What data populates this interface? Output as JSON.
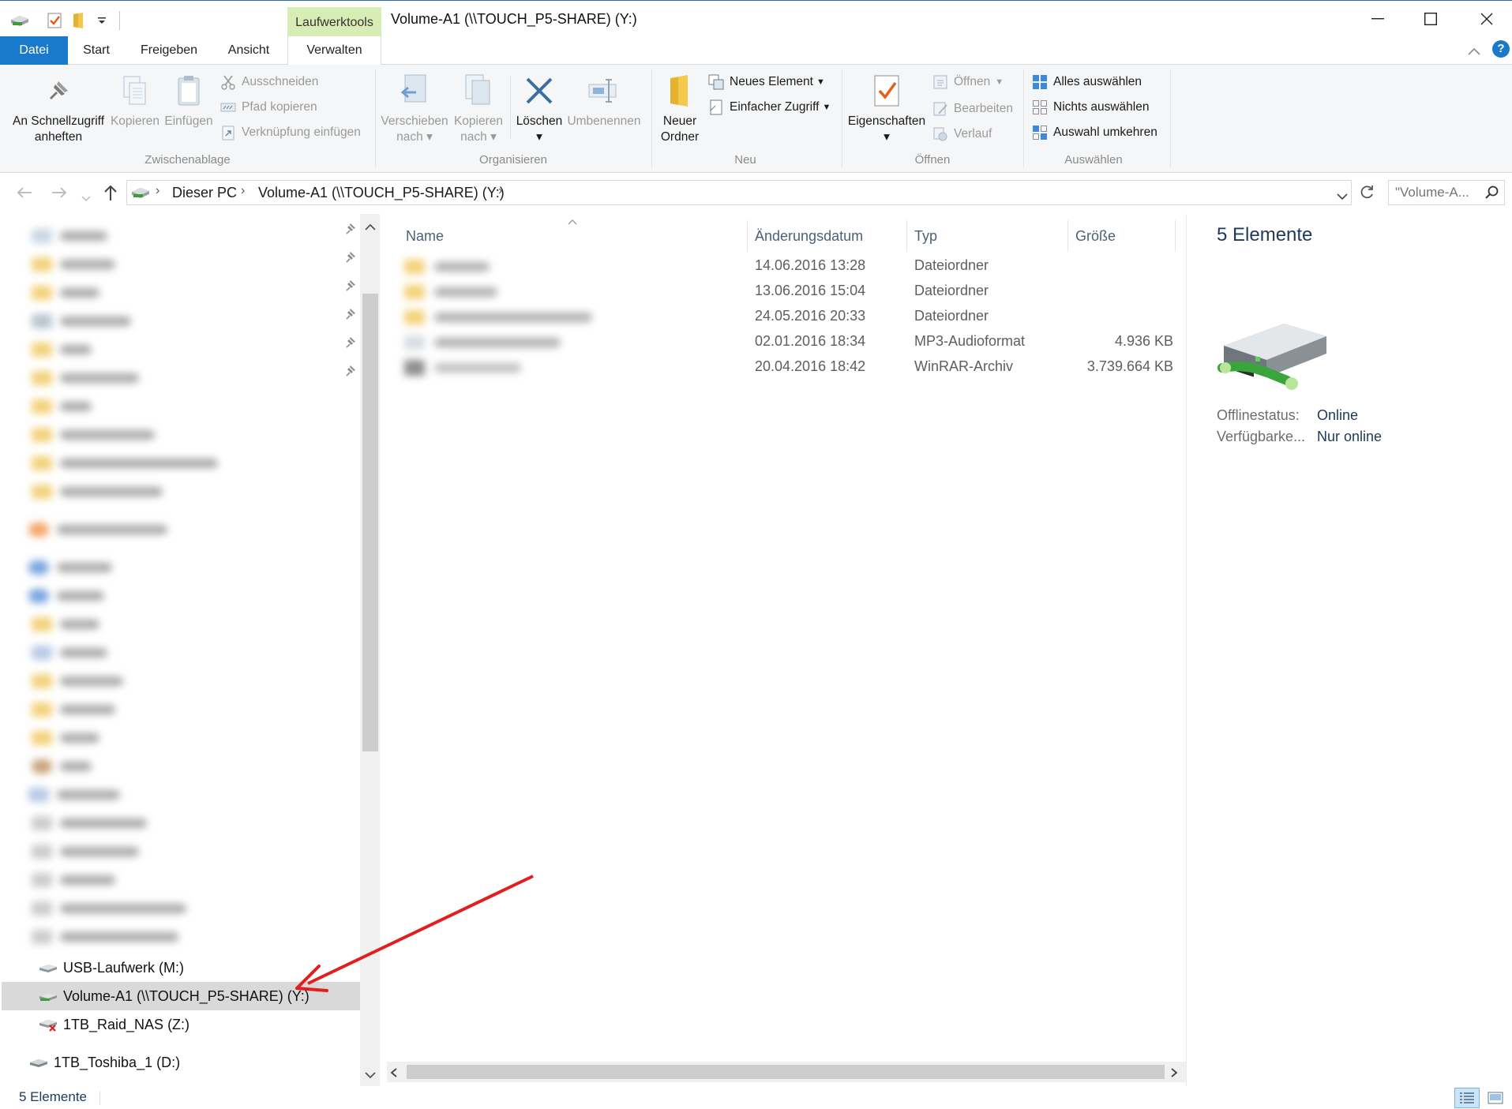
{
  "window": {
    "title": "Volume-A1 (\\\\TOUCH_P5-SHARE) (Y:)",
    "context_group": "Laufwerktools"
  },
  "tabs": {
    "file": "Datei",
    "start": "Start",
    "share": "Freigeben",
    "view": "Ansicht",
    "manage": "Verwalten"
  },
  "ribbon": {
    "clipboard": {
      "label": "Zwischenablage",
      "pin": "An Schnellzugriff anheften",
      "pin_l1": "An Schnellzugriff",
      "pin_l2": "anheften",
      "copy": "Kopieren",
      "paste": "Einfügen",
      "cut": "Ausschneiden",
      "copy_path": "Pfad kopieren",
      "paste_link": "Verknüpfung einfügen"
    },
    "organize": {
      "label": "Organisieren",
      "move_l1": "Verschieben",
      "move_l2": "nach",
      "copy_l1": "Kopieren",
      "copy_l2": "nach",
      "delete": "Löschen",
      "rename": "Umbenennen"
    },
    "new": {
      "label": "Neu",
      "new_folder_l1": "Neuer",
      "new_folder_l2": "Ordner",
      "new_item": "Neues Element",
      "easy_access": "Einfacher Zugriff"
    },
    "open": {
      "label": "Öffnen",
      "properties": "Eigenschaften",
      "open": "Öffnen",
      "edit": "Bearbeiten",
      "history": "Verlauf"
    },
    "select": {
      "label": "Auswählen",
      "select_all": "Alles auswählen",
      "select_none": "Nichts auswählen",
      "invert": "Auswahl umkehren"
    }
  },
  "address": {
    "crumb_1": "Dieser PC",
    "crumb_2": "Volume-A1 (\\\\TOUCH_P5-SHARE) (Y:)",
    "search_placeholder": "\"Volume-A..."
  },
  "nav": {
    "items": [
      {
        "label": "USB-Laufwerk (M:)",
        "icon": "usb-drive-icon"
      },
      {
        "label": "Volume-A1 (\\\\TOUCH_P5-SHARE) (Y:)",
        "icon": "network-drive-icon",
        "selected": true
      },
      {
        "label": "1TB_Raid_NAS (Z:)",
        "icon": "disconnected-drive-icon"
      },
      {
        "label": "1TB_Toshiba_1 (D:)",
        "icon": "hard-drive-icon"
      }
    ]
  },
  "filelist": {
    "headers": {
      "name": "Name",
      "date": "Änderungsdatum",
      "type": "Typ",
      "size": "Größe"
    },
    "rows": [
      {
        "date": "14.06.2016 13:28",
        "type": "Dateiordner",
        "size": ""
      },
      {
        "date": "13.06.2016 15:04",
        "type": "Dateiordner",
        "size": ""
      },
      {
        "date": "24.05.2016 20:33",
        "type": "Dateiordner",
        "size": ""
      },
      {
        "date": "02.01.2016 18:34",
        "type": "MP3-Audioformat",
        "size": "4.936 KB"
      },
      {
        "date": "20.04.2016 18:42",
        "type": "WinRAR-Archiv",
        "size": "3.739.664 KB"
      }
    ]
  },
  "details": {
    "title": "5 Elemente",
    "offline_key": "Offlinestatus:",
    "offline_val": "Online",
    "avail_key": "Verfügbarke...",
    "avail_val": "Nur online"
  },
  "status": {
    "count": "5 Elemente"
  },
  "colors": {
    "accent": "#1979ca",
    "context_tab": "#d8ecb5",
    "annotation_arrow": "#e31e1e"
  }
}
